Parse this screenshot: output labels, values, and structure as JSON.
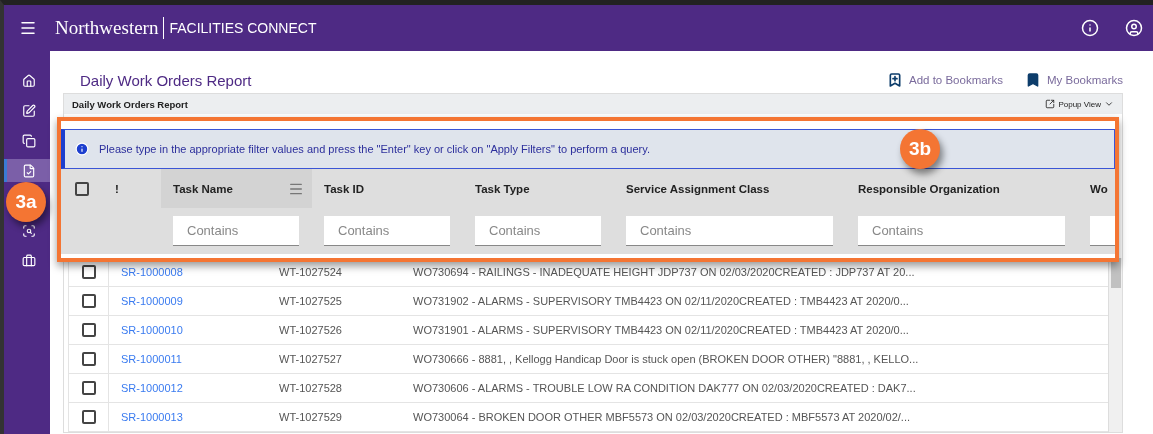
{
  "header": {
    "brand": "Northwestern",
    "product": "FACILITIES CONNECT"
  },
  "sidebar": {
    "items": [
      {
        "kind": "home",
        "selected": false
      },
      {
        "kind": "edit",
        "selected": false
      },
      {
        "kind": "copy",
        "selected": false
      },
      {
        "kind": "report",
        "selected": true
      },
      {
        "kind": "scan",
        "selected": false
      },
      {
        "kind": "briefcase",
        "selected": false
      }
    ]
  },
  "page": {
    "title": "Daily Work Orders Report",
    "actions": [
      {
        "kind": "add",
        "label": "Add to Bookmarks"
      },
      {
        "kind": "list",
        "label": "My Bookmarks"
      }
    ]
  },
  "report": {
    "title": "Daily Work Orders Report",
    "popup": "Popup View",
    "info": "Please type in the appropriate filter values and press the \"Enter\" key or click on \"Apply Filters\" to perform a query.",
    "columns": [
      {
        "kind": "check",
        "checked": false
      },
      {
        "kind": "flag",
        "label": "!"
      },
      {
        "kind": "text",
        "label": "Task Name",
        "placeholder": "Contains"
      },
      {
        "kind": "text",
        "label": "Task ID",
        "placeholder": "Contains"
      },
      {
        "kind": "text",
        "label": "Task Type",
        "placeholder": "Contains"
      },
      {
        "kind": "text",
        "label": "Service Assignment Class",
        "placeholder": "Contains"
      },
      {
        "kind": "text",
        "label": "Responsible Organization",
        "placeholder": "Contains"
      },
      {
        "kind": "text",
        "label": "Wo"
      }
    ],
    "rows": [
      {
        "checked": false,
        "id": "SR-1000008",
        "task": "WT-1027524",
        "description": "WO730694 - RAILINGS - INADEQUATE HEIGHT JDP737 ON 02/03/2020CREATED : JDP737 AT 20..."
      },
      {
        "checked": false,
        "id": "SR-1000009",
        "task": "WT-1027525",
        "description": "WO731902 - ALARMS - SUPERVISORY TMB4423 ON 02/11/2020CREATED : TMB4423 AT 2020/0..."
      },
      {
        "checked": false,
        "id": "SR-1000010",
        "task": "WT-1027526",
        "description": "WO731901 - ALARMS - SUPERVISORY TMB4423 ON 02/11/2020CREATED : TMB4423 AT 2020/0..."
      },
      {
        "checked": false,
        "id": "SR-1000011",
        "task": "WT-1027527",
        "description": "WO730666 - 8881, , Kellogg Handicap Door is stuck open (BROKEN DOOR OTHER) \"8881, , KELLO..."
      },
      {
        "checked": false,
        "id": "SR-1000012",
        "task": "WT-1027528",
        "description": "WO730606 - ALARMS - TROUBLE LOW RA CONDITION DAK777 ON 02/03/2020CREATED : DAK7..."
      },
      {
        "checked": false,
        "id": "SR-1000013",
        "task": "WT-1027529",
        "description": "WO730064 - BROKEN DOOR OTHER MBF5573 ON 02/03/2020CREATED : MBF5573 AT 2020/02/..."
      }
    ]
  },
  "callouts": [
    {
      "label": "3a"
    },
    {
      "label": "3b"
    }
  ]
}
